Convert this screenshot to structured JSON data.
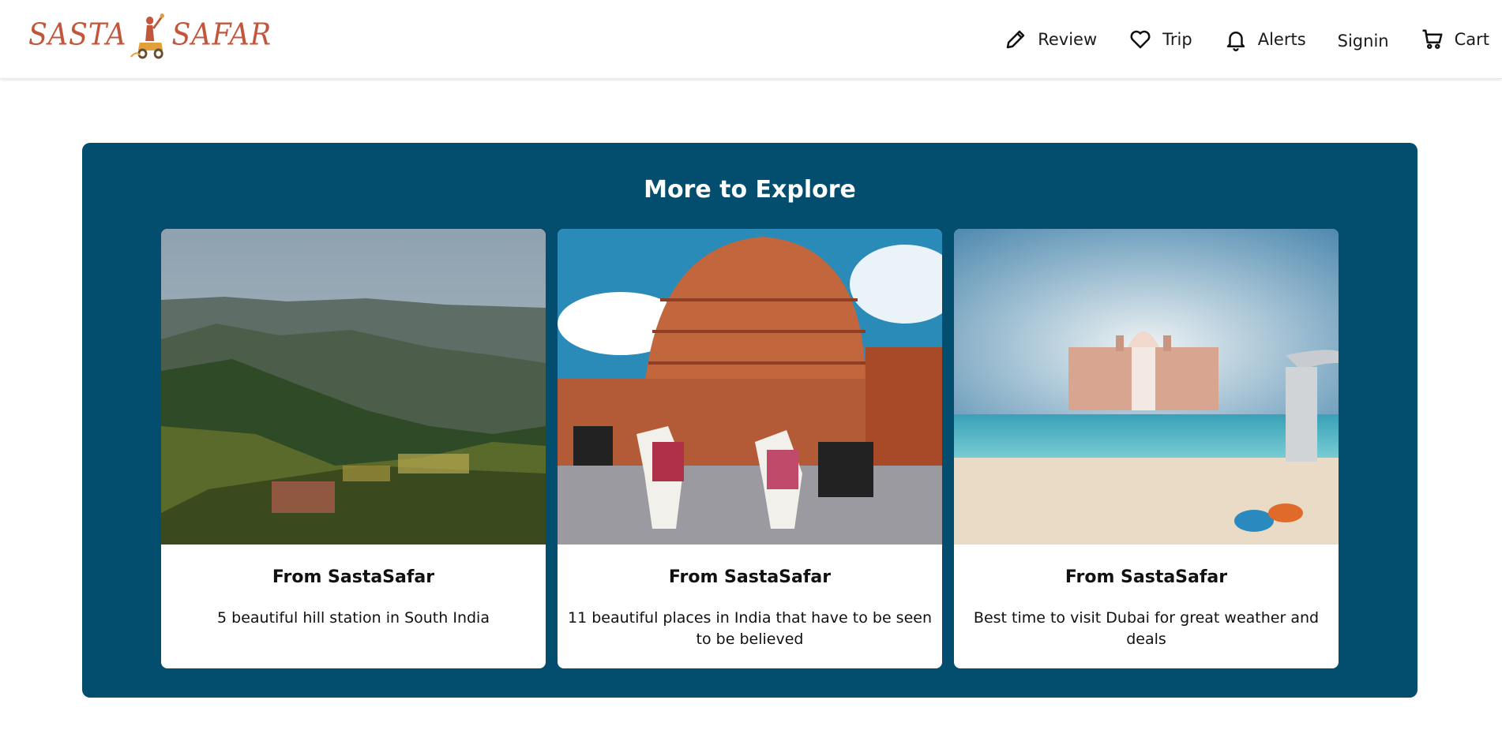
{
  "header": {
    "logo_text_left": "SASTA",
    "logo_text_right": "SAFAR",
    "nav": {
      "review": "Review",
      "trip": "Trip",
      "alerts": "Alerts",
      "signin": "Signin",
      "cart": "Cart"
    },
    "icons": {
      "review": "pencil-icon",
      "trip": "heart-icon",
      "alerts": "bell-icon",
      "cart": "cart-icon"
    }
  },
  "explore": {
    "title": "More to Explore",
    "background": "#034e6e",
    "cards": [
      {
        "kicker": "From SastaSafar",
        "description": "5 beautiful hill station in South India",
        "image": "hill-station-photo"
      },
      {
        "kicker": "From SastaSafar",
        "description": "11 beautiful places in India that have to be seen to be believed",
        "image": "hawa-mahal-photo"
      },
      {
        "kicker": "From SastaSafar",
        "description": "Best time to visit Dubai for great weather and deals",
        "image": "dubai-beach-photo"
      }
    ]
  },
  "colors": {
    "brand": "#c2553a",
    "panel": "#034e6e"
  }
}
